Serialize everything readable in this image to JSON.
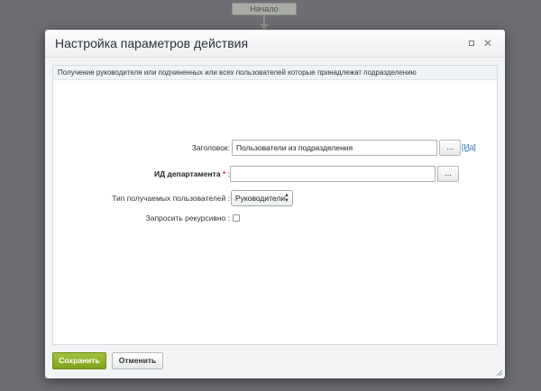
{
  "background": {
    "start_node_label": "Начало"
  },
  "dialog": {
    "title": "Настройка параметров действия",
    "description": "Получение руководителя или подчиненных или всех пользователей которые принадлежат подразделению",
    "fields": {
      "title": {
        "label": "Заголовок:",
        "value": "Пользователи из подразделения",
        "button_label": "...",
        "link_label": "[Ид]"
      },
      "department_id": {
        "label": "ИД департамента",
        "required_mark": "*",
        "label_suffix": ":",
        "value": "",
        "button_label": "..."
      },
      "user_type": {
        "label": "Тип получаемых пользователей :",
        "selected": "Руководители"
      },
      "recursive": {
        "label": "Запросить рекурсивно :",
        "checked": false
      }
    },
    "buttons": {
      "save": "Сохранить",
      "cancel": "Отменить"
    }
  },
  "colors": {
    "overlay": "#6c6e73",
    "save_button": "#8fb12a",
    "link": "#2261a6",
    "required": "#d0302b"
  }
}
